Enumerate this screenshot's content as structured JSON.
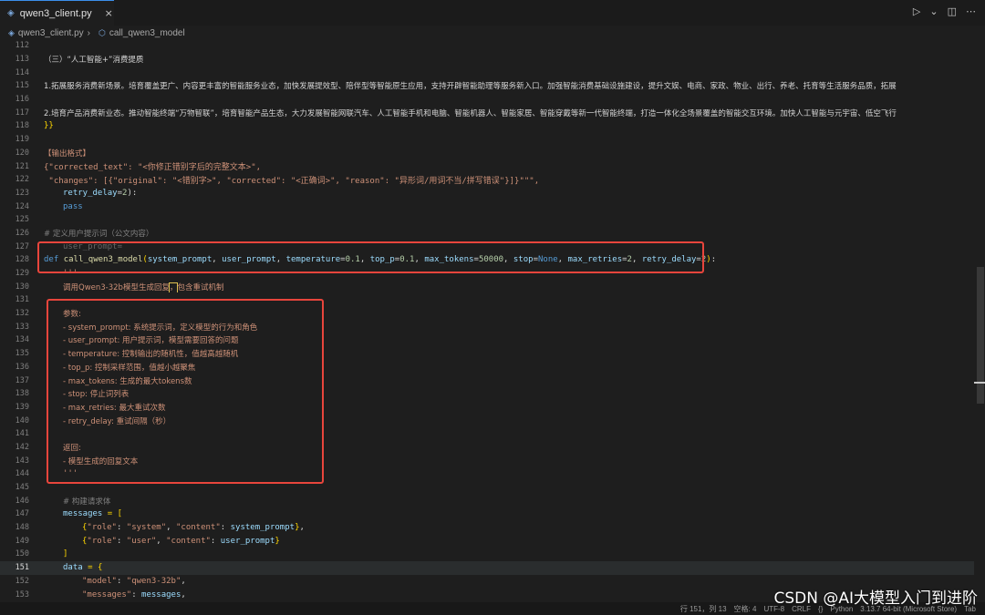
{
  "tab": {
    "label": "qwen3_client.py",
    "close": "×"
  },
  "breadcrumb": {
    "file": "qwen3_client.py",
    "separator": "›",
    "symbol": "call_qwen3_model"
  },
  "lines": {
    "112": {
      "num": "112"
    },
    "113": {
      "num": "113",
      "text": "（三）“人工智能+”消费提质"
    },
    "114": {
      "num": "114"
    },
    "115": {
      "num": "115",
      "text": "1.拓展服务消费新场景。培育覆盖更广、内容更丰富的智能服务业态，加快发展提效型、陪伴型等智能原生应用，支持开辟智能助理等服务新入口。加强智能消费基础设施建设，提升文娱、电商、家政、物业、出行、养老、托育等生活服务品质，拓展"
    },
    "116": {
      "num": "116"
    },
    "117": {
      "num": "117",
      "text": "2.培育产品消费新业态。推动智能终端“万物智联”，培育智能产品生态，大力发展智能网联汽车、人工智能手机和电脑、智能机器人、智能家居、智能穿戴等新一代智能终端，打造一体化全场景覆盖的智能交互环境。加快人工智能与元宇宙、低空飞行"
    },
    "118": {
      "num": "118",
      "text": "}}"
    },
    "119": {
      "num": "119"
    },
    "120": {
      "num": "120",
      "text": "【输出格式】"
    },
    "121": {
      "num": "121",
      "text": "{\"corrected_text\": \"<你修正错别字后的完整文本>\","
    },
    "122": {
      "num": "122",
      "text": " \"changes\": [{\"original\": \"<错别字>\", \"corrected\": \"<正确词>\", \"reason\": \"异形词/用词不当/拼写错误\"}]}\"\"\","
    },
    "123": {
      "num": "123",
      "a": "retry_delay",
      "b": "=",
      "c": "2",
      "d": "):"
    },
    "124": {
      "num": "124",
      "text": "pass"
    },
    "125": {
      "num": "125"
    },
    "126": {
      "num": "126",
      "text": "# 定义用户提示词（公文内容）"
    },
    "127": {
      "num": "127",
      "text": "user_prompt="
    },
    "128": {
      "num": "128",
      "def": "def",
      "fn": "call_qwen3_model",
      "p1": "system_prompt",
      "p2": "user_prompt",
      "p3": "temperature",
      "v3": "0.1",
      "p4": "top_p",
      "v4": "0.1",
      "p5": "max_tokens",
      "v5": "50000",
      "p6": "stop",
      "v6": "None",
      "p7": "max_retries",
      "v7": "2",
      "p8": "retry_delay",
      "v8": "2"
    },
    "129": {
      "num": "129",
      "text": "'''"
    },
    "130": {
      "num": "130",
      "pre": "调用Qwen3-32b模型生成回复",
      "cursor": "，",
      "post": "包含重试机制"
    },
    "131": {
      "num": "131"
    },
    "132": {
      "num": "132",
      "text": "参数:"
    },
    "133": {
      "num": "133",
      "text": "- system_prompt: 系统提示词，定义模型的行为和角色"
    },
    "134": {
      "num": "134",
      "text": "- user_prompt: 用户提示词，模型需要回答的问题"
    },
    "135": {
      "num": "135",
      "text": "- temperature: 控制输出的随机性，值越高越随机"
    },
    "136": {
      "num": "136",
      "text": "- top_p: 控制采样范围，值越小越聚焦"
    },
    "137": {
      "num": "137",
      "text": "- max_tokens: 生成的最大tokens数"
    },
    "138": {
      "num": "138",
      "text": "- stop: 停止词列表"
    },
    "139": {
      "num": "139",
      "text": "- max_retries: 最大重试次数"
    },
    "140": {
      "num": "140",
      "text": "- retry_delay: 重试间隔（秒）"
    },
    "141": {
      "num": "141"
    },
    "142": {
      "num": "142",
      "text": "返回:"
    },
    "143": {
      "num": "143",
      "text": "- 模型生成的回复文本"
    },
    "144": {
      "num": "144",
      "text": "'''"
    },
    "145": {
      "num": "145"
    },
    "146": {
      "num": "146",
      "text": "# 构建请求体"
    },
    "147": {
      "num": "147",
      "a": "messages",
      "b": " = ["
    },
    "148": {
      "num": "148",
      "k1": "\"role\"",
      "v1": "\"system\"",
      "k2": "\"content\"",
      "v2": "system_prompt"
    },
    "149": {
      "num": "149",
      "k1": "\"role\"",
      "v1": "\"user\"",
      "k2": "\"content\"",
      "v2": "user_prompt"
    },
    "150": {
      "num": "150",
      "text": "]"
    },
    "151": {
      "num": "151",
      "a": "data",
      "b": " = {"
    },
    "152": {
      "num": "152",
      "k": "\"model\"",
      "v": "\"qwen3-32b\""
    },
    "153": {
      "num": "153",
      "k": "\"messages\"",
      "v": "messages"
    }
  },
  "status": {
    "cursor": "行 151，列 13",
    "spaces": "空格: 4",
    "encoding": "UTF-8",
    "eol": "CRLF",
    "braces": "{}",
    "language": "Python",
    "interpreter": "3.13.7 64-bit (Microsoft Store)",
    "tab": "Tab"
  },
  "watermark": "CSDN @AI大模型入门到进阶",
  "colors": {
    "annotation_box": "#e8453c",
    "keyword": "#569cd6",
    "function": "#dcdcaa",
    "string": "#ce9178",
    "number": "#b5cea8",
    "comment": "#6a9955",
    "parameter": "#9cdcfe"
  }
}
